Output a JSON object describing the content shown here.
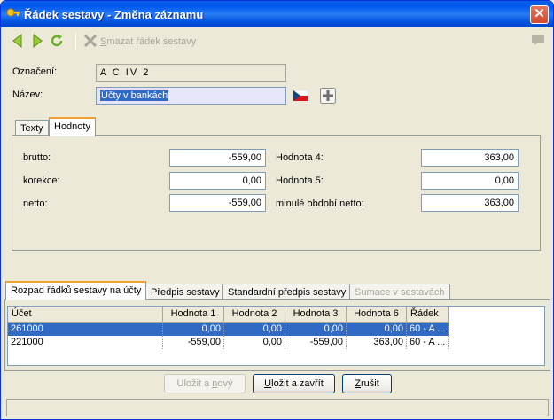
{
  "window": {
    "title": "Řádek sestavy - Změna záznamu",
    "close_label": "✕"
  },
  "toolbar": {
    "delete_prefix": "S",
    "delete_rest": "mazat řádek sestavy"
  },
  "form": {
    "oznaceni_label": "Označení:",
    "oznaceni_value": "A C IV 2",
    "nazev_label": "Název:",
    "nazev_value": "Účty v bankách"
  },
  "tabs_top": [
    {
      "label": "Texty"
    },
    {
      "label": "Hodnoty"
    }
  ],
  "values": {
    "brutto_label": "brutto:",
    "brutto": "-559,00",
    "korekce_label": "korekce:",
    "korekce": "0,00",
    "netto_label": "netto:",
    "netto": "-559,00",
    "h4_label": "Hodnota 4:",
    "h4": "363,00",
    "h5_label": "Hodnota 5:",
    "h5": "0,00",
    "minule_label": "minulé období netto:",
    "minule": "363,00"
  },
  "tabs_bottom": [
    {
      "label": "Rozpad řádků sestavy na účty"
    },
    {
      "label": "Předpis sestavy"
    },
    {
      "label": "Standardní předpis sestavy"
    },
    {
      "label": "Sumace v sestavách"
    }
  ],
  "grid": {
    "columns": [
      "Účet",
      "Hodnota 1",
      "Hodnota 2",
      "Hodnota 3",
      "Hodnota 6",
      "Řádek"
    ],
    "rows": [
      [
        "261000",
        "0,00",
        "0,00",
        "0,00",
        "0,00",
        "60 - A  ..."
      ],
      [
        "221000",
        "-559,00",
        "0,00",
        "-559,00",
        "363,00",
        "60 - A  ..."
      ]
    ]
  },
  "buttons": {
    "save_new_pre": "Uložit a ",
    "save_new_ul": "n",
    "save_new_post": "ový",
    "save_close_pre": "U",
    "save_close_post": "ložit a zavřít",
    "cancel_pre": "Z",
    "cancel_post": "rušit"
  },
  "colors": {
    "accent": "#316AC5",
    "title_bar": "#0058EE",
    "tab_highlight": "#F0A030"
  },
  "icons": [
    "app-icon",
    "back-icon",
    "forward-icon",
    "refresh-icon",
    "delete-icon",
    "comment-icon",
    "czech-flag-icon",
    "add-icon"
  ]
}
